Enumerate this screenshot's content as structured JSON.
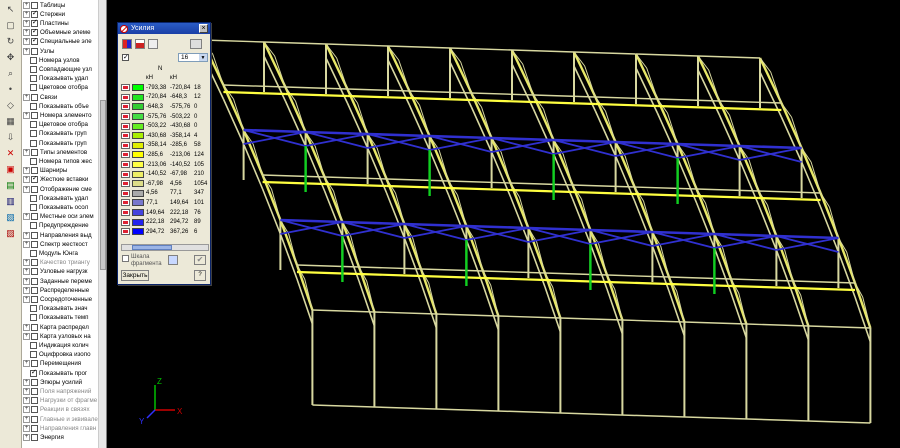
{
  "dialog": {
    "title": "Усилия",
    "close_glyph": "×",
    "unit_header": "N",
    "col1_header": "кН",
    "col2_header": "кН",
    "count_value": "16",
    "fragment_label_1": "Шкала",
    "fragment_label_2": "фрагмента",
    "close_label": "Закрыть",
    "scale": [
      {
        "from": "-793,38",
        "to": "-720,84",
        "count": "18",
        "color": "#00ff00"
      },
      {
        "from": "-720,84",
        "to": "-648,3",
        "count": "12",
        "color": "#22e622"
      },
      {
        "from": "-648,3",
        "to": "-575,76",
        "count": "0",
        "color": "#33cc33"
      },
      {
        "from": "-575,76",
        "to": "-503,22",
        "count": "0",
        "color": "#44dd44"
      },
      {
        "from": "-503,22",
        "to": "-430,68",
        "count": "0",
        "color": "#66ee22"
      },
      {
        "from": "-430,68",
        "to": "-358,14",
        "count": "4",
        "color": "#aaee00"
      },
      {
        "from": "-358,14",
        "to": "-285,6",
        "count": "58",
        "color": "#e0ee00"
      },
      {
        "from": "-285,6",
        "to": "-213,06",
        "count": "124",
        "color": "#ffff00"
      },
      {
        "from": "-213,06",
        "to": "-140,52",
        "count": "105",
        "color": "#ffff44"
      },
      {
        "from": "-140,52",
        "to": "-67,98",
        "count": "210",
        "color": "#eeee66"
      },
      {
        "from": "-67,98",
        "to": "4,56",
        "count": "1054",
        "color": "#dddd88"
      },
      {
        "from": "4,56",
        "to": "77,1",
        "count": "347",
        "color": "#aaaaaa"
      },
      {
        "from": "77,1",
        "to": "149,64",
        "count": "101",
        "color": "#7777cc"
      },
      {
        "from": "149,64",
        "to": "222,18",
        "count": "76",
        "color": "#4444dd"
      },
      {
        "from": "222,18",
        "to": "294,72",
        "count": "89",
        "color": "#2222ee"
      },
      {
        "from": "294,72",
        "to": "367,26",
        "count": "6",
        "color": "#0000ff"
      }
    ]
  },
  "tree": [
    {
      "label": "Таблицы",
      "checked": false,
      "gray": false,
      "exp": "+"
    },
    {
      "label": "Стержни",
      "checked": true,
      "gray": false,
      "exp": "+"
    },
    {
      "label": "Пластины",
      "checked": true,
      "gray": false,
      "exp": "+"
    },
    {
      "label": "Объемные элеме",
      "checked": true,
      "gray": false,
      "exp": "+"
    },
    {
      "label": "Специальные эле",
      "checked": true,
      "gray": false,
      "exp": "+"
    },
    {
      "label": "Узлы",
      "checked": false,
      "gray": false,
      "exp": "+"
    },
    {
      "label": "Номера узлов",
      "checked": false,
      "gray": false,
      "exp": ""
    },
    {
      "label": "Совпадающие узл",
      "checked": false,
      "gray": false,
      "exp": ""
    },
    {
      "label": "Показывать удал",
      "checked": false,
      "gray": false,
      "exp": ""
    },
    {
      "label": "Цветовое отобра",
      "checked": false,
      "gray": false,
      "exp": ""
    },
    {
      "label": "Связи",
      "checked": false,
      "gray": false,
      "exp": "+"
    },
    {
      "label": "Показывать объе",
      "checked": false,
      "gray": false,
      "exp": ""
    },
    {
      "label": "Номера элементо",
      "checked": false,
      "gray": false,
      "exp": "+"
    },
    {
      "label": "Цветовое отобра",
      "checked": false,
      "gray": false,
      "exp": ""
    },
    {
      "label": "Показывать груп",
      "checked": false,
      "gray": false,
      "exp": ""
    },
    {
      "label": "Показывать груп",
      "checked": false,
      "gray": false,
      "exp": ""
    },
    {
      "label": "Типы элементов",
      "checked": false,
      "gray": false,
      "exp": "+"
    },
    {
      "label": "Номера типов жес",
      "checked": false,
      "gray": false,
      "exp": ""
    },
    {
      "label": "Шарниры",
      "checked": false,
      "gray": false,
      "exp": "+"
    },
    {
      "label": "Жесткие вставки",
      "checked": true,
      "gray": false,
      "exp": "+"
    },
    {
      "label": "Отображение сме",
      "checked": false,
      "gray": false,
      "exp": "+"
    },
    {
      "label": "Показывать удал",
      "checked": false,
      "gray": false,
      "exp": ""
    },
    {
      "label": "Показывать осол",
      "checked": false,
      "gray": false,
      "exp": ""
    },
    {
      "label": "Местные оси элем",
      "checked": false,
      "gray": false,
      "exp": "+"
    },
    {
      "label": "Предупреждение",
      "checked": false,
      "gray": false,
      "exp": ""
    },
    {
      "label": "Направления выд",
      "checked": false,
      "gray": false,
      "exp": "+"
    },
    {
      "label": "Спектр жесткост",
      "checked": false,
      "gray": false,
      "exp": "+"
    },
    {
      "label": "Модуль Юнга",
      "checked": false,
      "gray": false,
      "exp": ""
    },
    {
      "label": "Качество триангу",
      "checked": false,
      "gray": true,
      "exp": "+"
    },
    {
      "label": "Узловые нагрузк",
      "checked": false,
      "gray": false,
      "exp": "+"
    },
    {
      "label": "Заданные переме",
      "checked": false,
      "gray": false,
      "exp": "+"
    },
    {
      "label": "Распределенные",
      "checked": false,
      "gray": false,
      "exp": "+"
    },
    {
      "label": "Сосредоточенные",
      "checked": false,
      "gray": false,
      "exp": "+"
    },
    {
      "label": "Показывать знач",
      "checked": false,
      "gray": false,
      "exp": ""
    },
    {
      "label": "Показывать темп",
      "checked": false,
      "gray": false,
      "exp": ""
    },
    {
      "label": "Карта распредел",
      "checked": false,
      "gray": false,
      "exp": "+"
    },
    {
      "label": "Карта узловых на",
      "checked": false,
      "gray": false,
      "exp": "+"
    },
    {
      "label": "Индикация колич",
      "checked": false,
      "gray": false,
      "exp": ""
    },
    {
      "label": "Оцифровка изопо",
      "checked": false,
      "gray": false,
      "exp": ""
    },
    {
      "label": "Перемещения",
      "checked": false,
      "gray": false,
      "exp": "+"
    },
    {
      "label": "Показывать прог",
      "checked": true,
      "gray": false,
      "exp": ""
    },
    {
      "label": "Эпюры усилий",
      "checked": false,
      "gray": false,
      "exp": "+"
    },
    {
      "label": "Поля напряжений",
      "checked": false,
      "gray": true,
      "exp": "+"
    },
    {
      "label": "Нагрузки от фрагме",
      "checked": false,
      "gray": true,
      "exp": "+"
    },
    {
      "label": "Реакции в связях",
      "checked": false,
      "gray": true,
      "exp": "+"
    },
    {
      "label": "Главные и эквивале",
      "checked": false,
      "gray": true,
      "exp": "+"
    },
    {
      "label": "Направления главн",
      "checked": false,
      "gray": true,
      "exp": "+"
    },
    {
      "label": "Энергия",
      "checked": false,
      "gray": false,
      "exp": "+"
    }
  ],
  "axes": {
    "x": "X",
    "y": "Y",
    "z": "Z"
  }
}
